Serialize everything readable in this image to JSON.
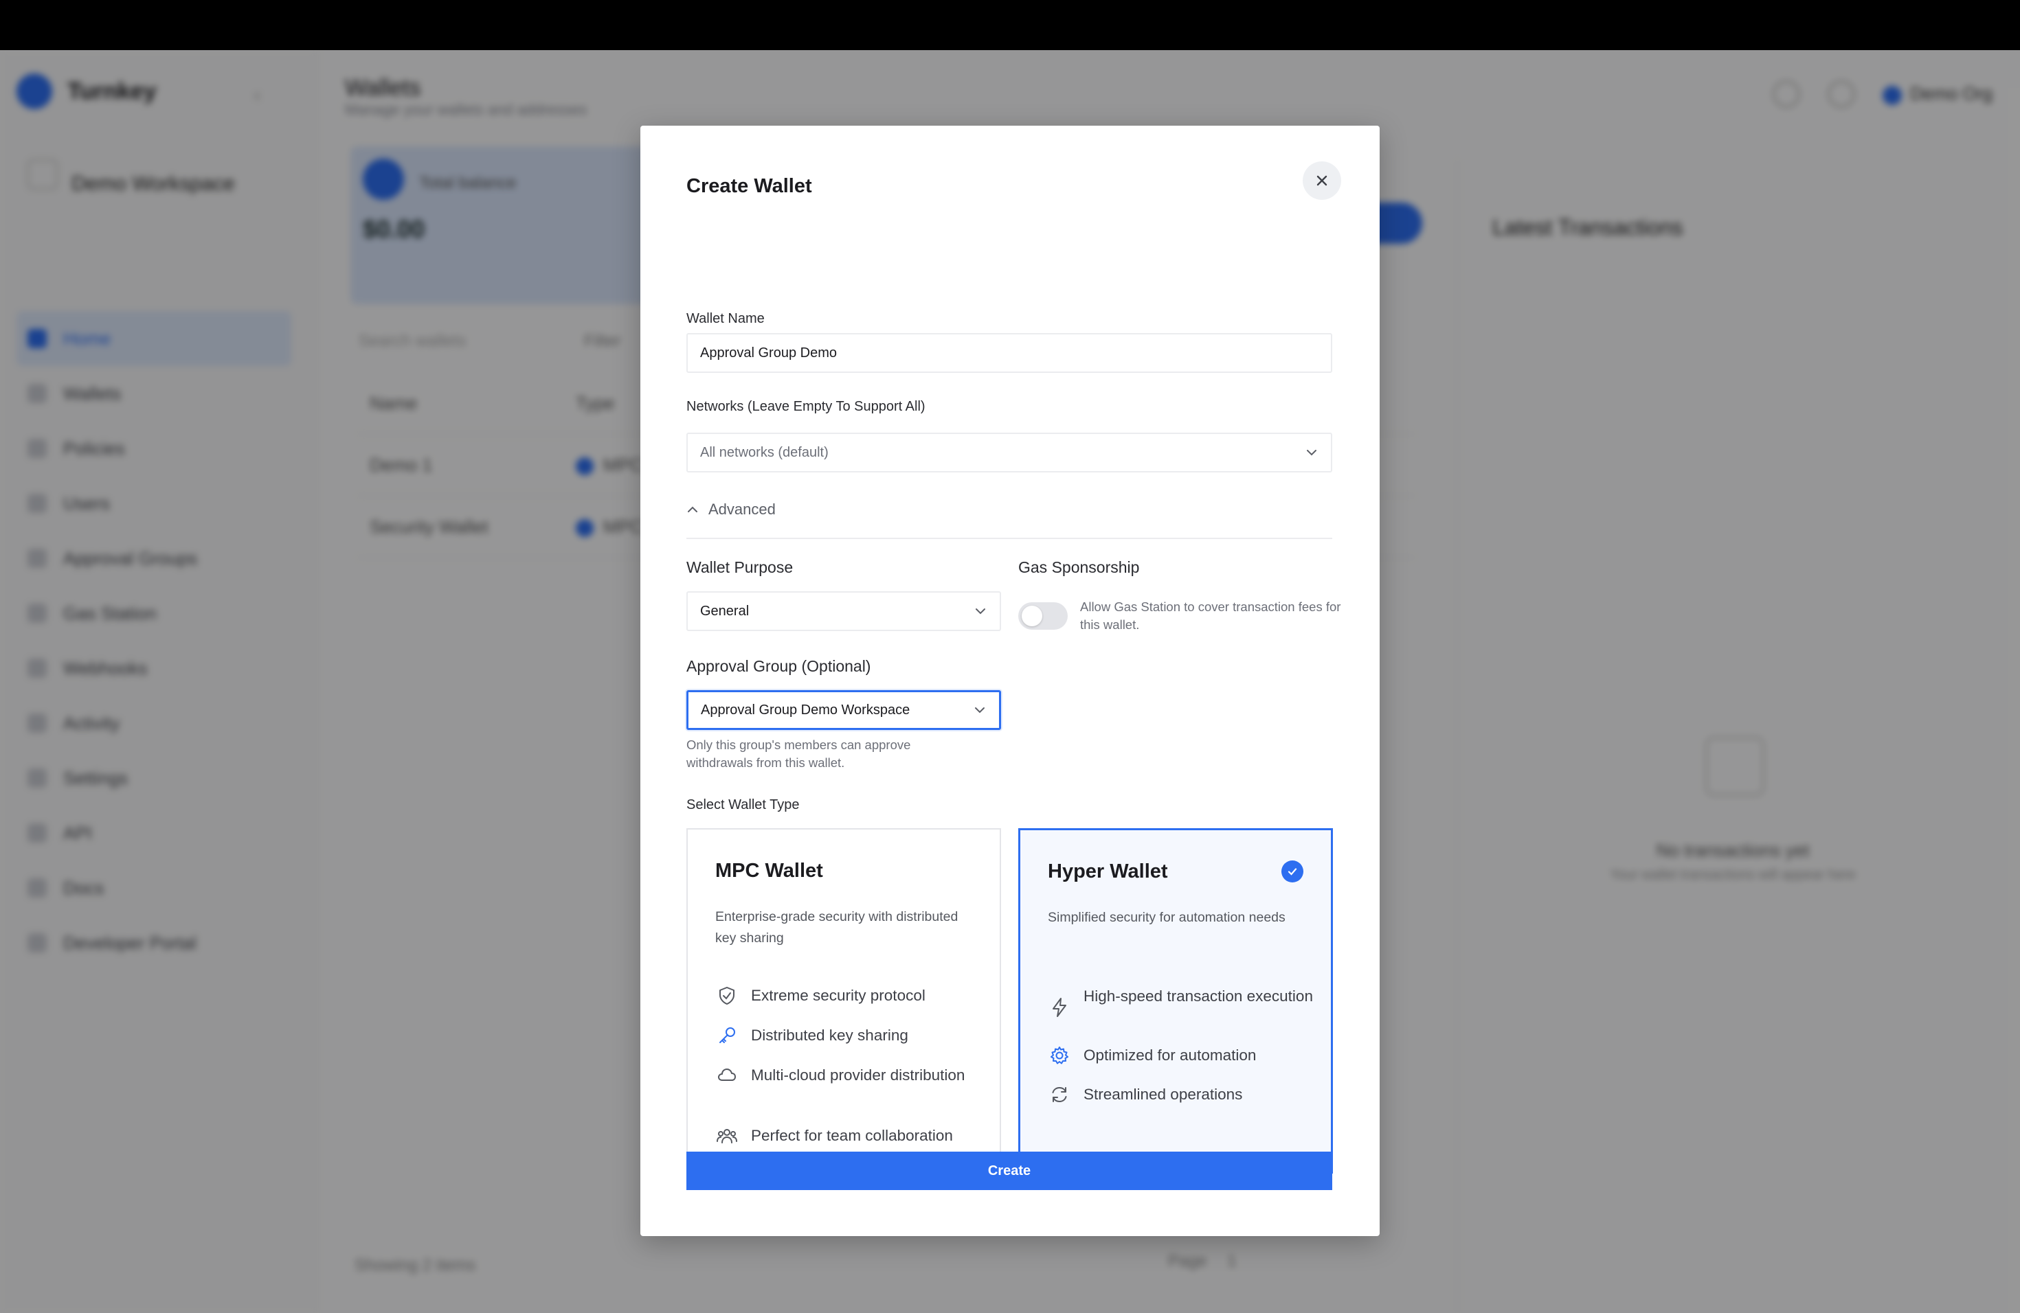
{
  "background": {
    "brand": "Turnkey",
    "workspace": "Demo Workspace",
    "nav_items": [
      "Home",
      "Wallets",
      "Policies",
      "Users",
      "Approval Groups",
      "Gas Station",
      "Webhooks",
      "Activity",
      "Settings",
      "API",
      "Docs",
      "Developer Portal"
    ],
    "page_title": "Wallets",
    "page_subtitle": "Manage your wallets and addresses",
    "account": "Demo Org",
    "balance_label": "Total balance",
    "balance_value": "$0.00",
    "search_placeholder": "Search wallets",
    "filter_label": "Filter",
    "table_headers": [
      "Name",
      "Type"
    ],
    "table_rows": [
      {
        "name": "Demo 1",
        "type": "MPC"
      },
      {
        "name": "Security Wallet",
        "type": "MPC"
      }
    ],
    "footer_text": "Showing 2 items",
    "pager_label": "Page",
    "pager_value": "1",
    "right_panel_title": "Latest Transactions",
    "right_empty_title": "No transactions yet",
    "right_empty_sub": "Your wallet transactions will appear here"
  },
  "modal": {
    "title": "Create Wallet",
    "wallet_name": {
      "label": "Wallet Name",
      "value": "Approval Group Demo"
    },
    "networks": {
      "label": "Networks (Leave Empty To Support All)",
      "placeholder": "All networks (default)"
    },
    "advanced_label": "Advanced",
    "wallet_purpose": {
      "label": "Wallet Purpose",
      "value": "General"
    },
    "gas_sponsorship": {
      "label": "Gas Sponsorship",
      "text": "Allow Gas Station to cover transaction fees for this wallet.",
      "enabled": false
    },
    "approval_group": {
      "label": "Approval Group (Optional)",
      "value": "Approval Group Demo Workspace",
      "help": "Only this group's members can approve withdrawals from this wallet."
    },
    "wallet_type_label": "Select Wallet Type",
    "wallet_types": [
      {
        "title": "MPC Wallet",
        "description": "Enterprise-grade security with distributed key sharing",
        "selected": false,
        "features": [
          {
            "icon": "shield-check-icon",
            "text": "Extreme security protocol"
          },
          {
            "icon": "key-icon",
            "text": "Distributed key sharing"
          },
          {
            "icon": "cloud-icon",
            "text": "Multi-cloud provider distribution"
          },
          {
            "icon": "users-icon",
            "text": "Perfect for team collaboration"
          }
        ]
      },
      {
        "title": "Hyper Wallet",
        "description": "Simplified security for automation needs",
        "selected": true,
        "features": [
          {
            "icon": "lightning-icon",
            "text": "High-speed transaction execution"
          },
          {
            "icon": "gear-icon",
            "text": "Optimized for automation"
          },
          {
            "icon": "refresh-icon",
            "text": "Streamlined operations"
          }
        ]
      }
    ],
    "create_label": "Create"
  },
  "colors": {
    "accent": "#2d6ef0",
    "overlay": "rgba(0,0,0,0.40)"
  }
}
